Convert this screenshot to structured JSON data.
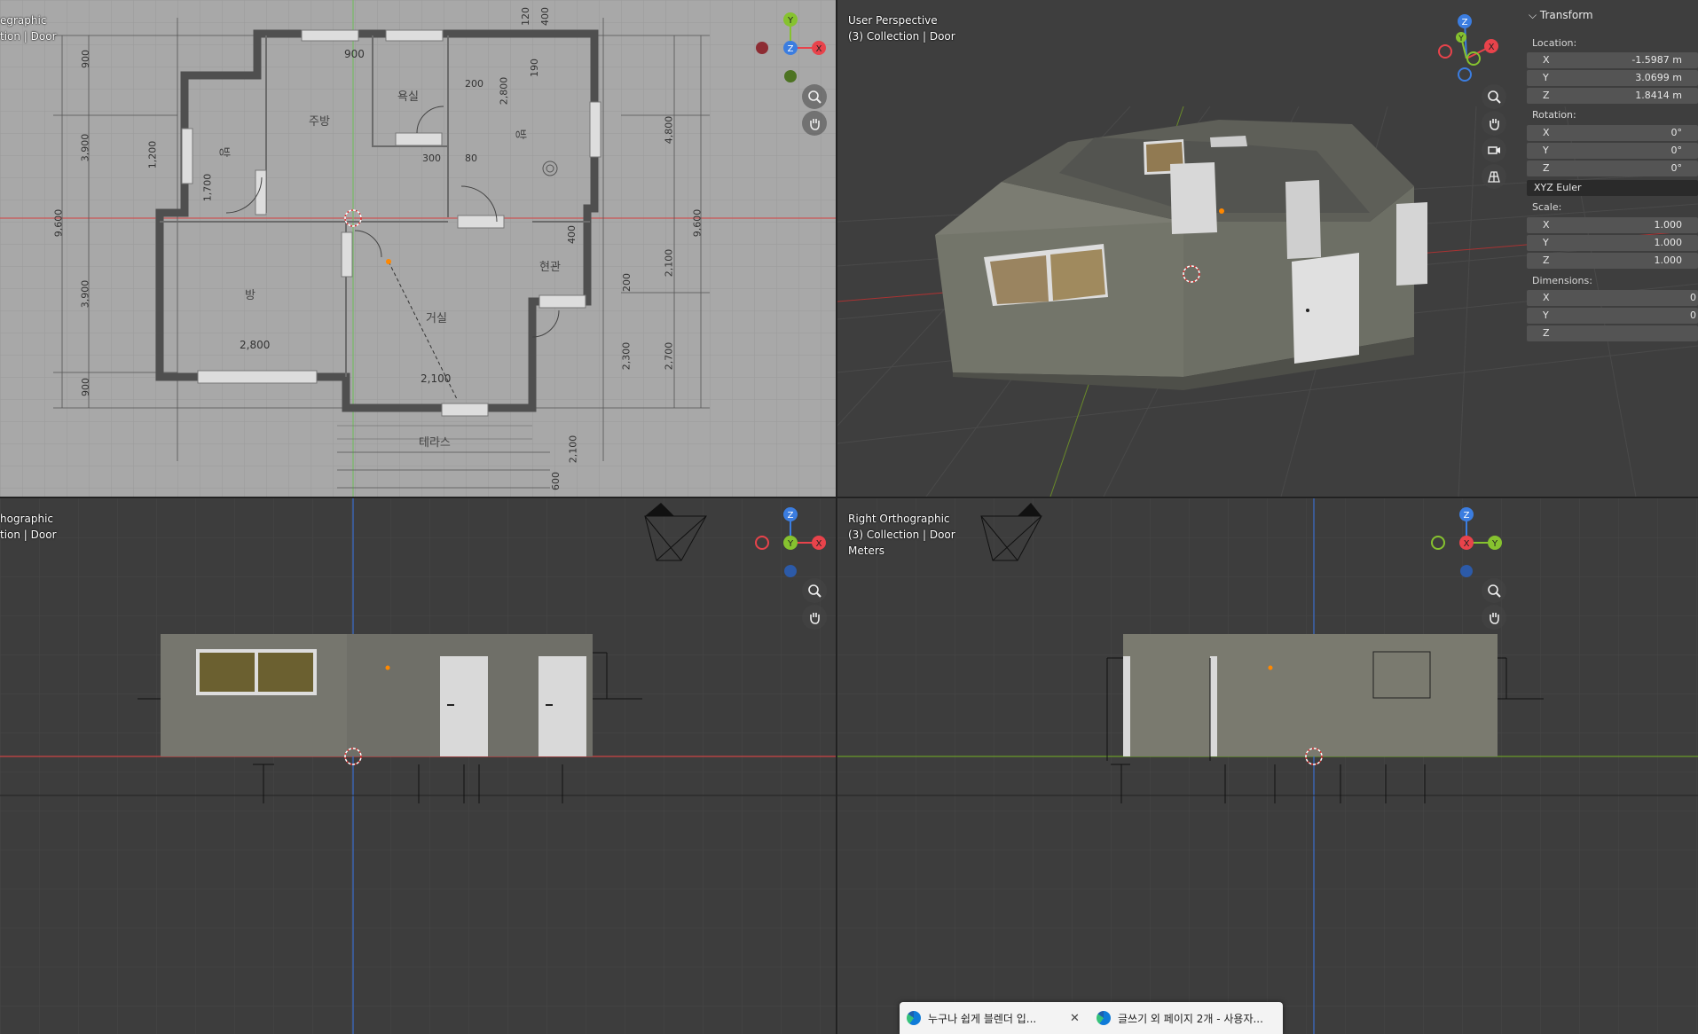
{
  "viewports": {
    "top_left": {
      "view_name": "egraphic",
      "collection": "tion | Door"
    },
    "top_right": {
      "view_name": "User Perspective",
      "collection": "(3) Collection | Door"
    },
    "bottom_left": {
      "view_name": "hographic",
      "collection": "tion | Door"
    },
    "bottom_right": {
      "view_name": "Right Orthographic",
      "collection": "(3) Collection | Door",
      "units": "Meters"
    }
  },
  "floorplan": {
    "dims_top": [
      "900",
      "120",
      "400",
      "900"
    ],
    "dims_left": [
      "900",
      "3,900",
      "9,600",
      "3,900",
      "900",
      "1,200",
      "1,700"
    ],
    "dims_right": [
      "4,800",
      "9,600",
      "2,100",
      "2,700",
      "2,300"
    ],
    "dims_inner": [
      "200",
      "2,800",
      "190",
      "80",
      "300",
      "200",
      "2,800",
      "2,100",
      "2,100",
      "600",
      "400"
    ],
    "rooms": [
      "주방",
      "욕실",
      "방",
      "방",
      "방",
      "거실",
      "현관",
      "테라스"
    ]
  },
  "gizmo_labels": {
    "x": "X",
    "y": "Y",
    "z": "Z"
  },
  "transform_panel": {
    "title": "Transform",
    "location_label": "Location:",
    "location": [
      {
        "axis": "X",
        "value": "-1.5987 m"
      },
      {
        "axis": "Y",
        "value": "3.0699 m"
      },
      {
        "axis": "Z",
        "value": "1.8414 m"
      }
    ],
    "rotation_label": "Rotation:",
    "rotation": [
      {
        "axis": "X",
        "value": "0°"
      },
      {
        "axis": "Y",
        "value": "0°"
      },
      {
        "axis": "Z",
        "value": "0°"
      }
    ],
    "rotation_mode": "XYZ Euler",
    "scale_label": "Scale:",
    "scale": [
      {
        "axis": "X",
        "value": "1.000"
      },
      {
        "axis": "Y",
        "value": "1.000"
      },
      {
        "axis": "Z",
        "value": "1.000"
      }
    ],
    "dimensions_label": "Dimensions:",
    "dimensions": [
      {
        "axis": "X",
        "value": "0"
      },
      {
        "axis": "Y",
        "value": "0"
      },
      {
        "axis": "Z",
        "value": ""
      }
    ]
  },
  "taskbar": {
    "items": [
      {
        "label": "누구나 쉽게 블렌더 입...",
        "icon": "edge-browser-icon"
      },
      {
        "label": "글쓰기 외 페이지 2개 - 사용자...",
        "icon": "edge-browser-icon"
      }
    ],
    "close_symbol": "✕"
  },
  "colors": {
    "x_axis": "#e8434b",
    "y_axis": "#86c22f",
    "z_axis": "#3b7de0",
    "viewport_bg": "#3d3d3d",
    "blueprint_bg": "#a9a9a9"
  }
}
